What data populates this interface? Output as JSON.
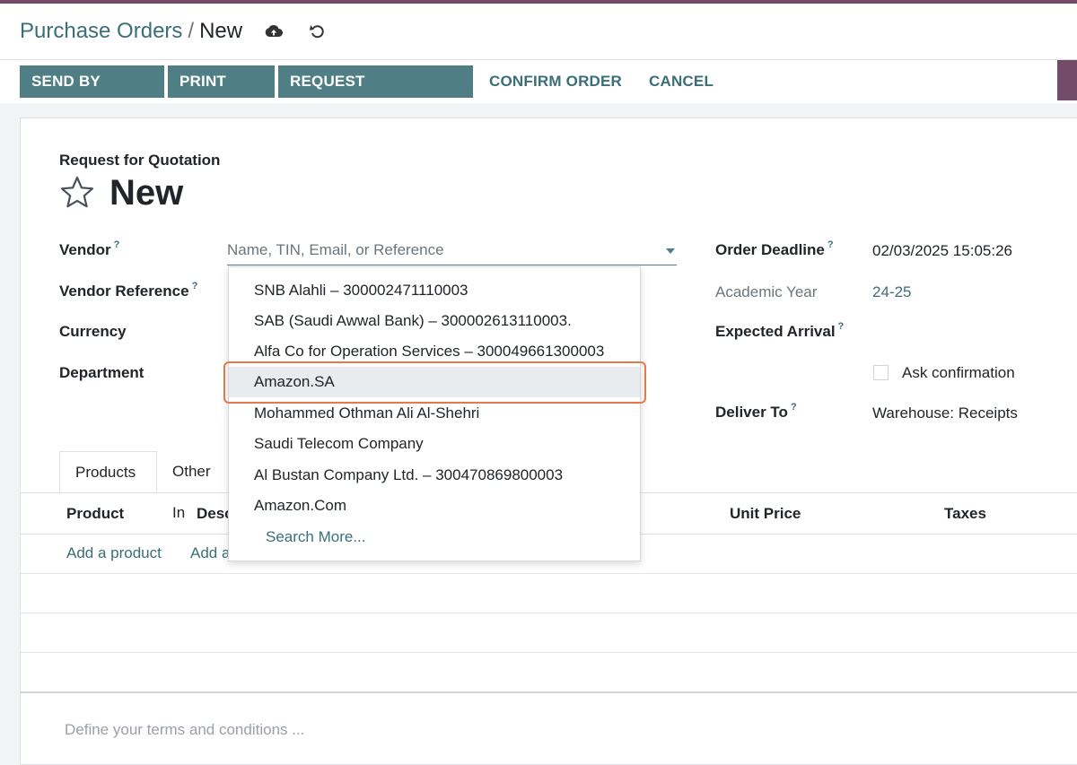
{
  "breadcrumb": {
    "parent": "Purchase Orders",
    "separator": "/",
    "current": "New"
  },
  "header_icons": [
    "cloud-upload-icon",
    "discard-icon"
  ],
  "toolbar": {
    "send_by_email": "SEND BY EMAIL",
    "print_rfq": "PRINT RFQ",
    "request_approvals": "REQUEST APPROVALS",
    "confirm_order": "CONFIRM ORDER",
    "cancel": "CANCEL"
  },
  "form": {
    "doc_type": "Request for Quotation",
    "title": "New",
    "labels": {
      "vendor": "Vendor",
      "vendor_reference": "Vendor Reference",
      "currency": "Currency",
      "department": "Department",
      "order_deadline": "Order Deadline",
      "academic_year": "Academic Year",
      "expected_arrival": "Expected Arrival",
      "ask_confirmation": "Ask confirmation",
      "deliver_to": "Deliver To"
    },
    "help_mark": "?",
    "vendor_placeholder": "Name, TIN, Email, or Reference",
    "order_deadline_value": "02/03/2025 15:05:26",
    "academic_year_value": "24-25",
    "deliver_to_value": "Warehouse: Receipts"
  },
  "vendor_dropdown": {
    "items": [
      "SNB Alahli – 300002471110003",
      "SAB (Saudi Awwal Bank) – 300002613110003.",
      "Alfa Co for Operation Services – 300049661300003",
      "Amazon.SA",
      "Mohammed Othman Ali Al-Shehri",
      "Saudi Telecom Company",
      "Al Bustan Company Ltd. – 300470869800003",
      "Amazon.Com"
    ],
    "active_index": 3,
    "search_more": "Search More..."
  },
  "tabs": [
    "Products",
    "Other In"
  ],
  "table": {
    "headers": {
      "product": "Product",
      "description": "Desc",
      "unit_price": "Unit Price",
      "taxes": "Taxes"
    },
    "add_product": "Add a product",
    "add_section": "Add a"
  },
  "terms_placeholder": "Define your terms and conditions ...",
  "colors": {
    "brand": "#714b67",
    "primary_button": "#4f7f85",
    "link": "#3a6e78",
    "highlight": "#e8774a"
  }
}
